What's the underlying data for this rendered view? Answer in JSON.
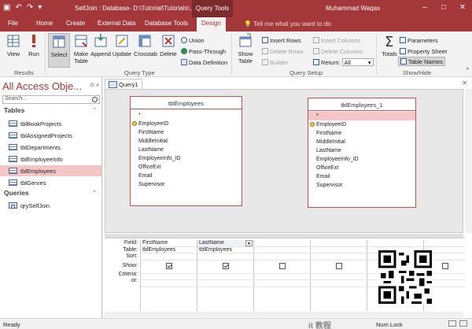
{
  "title_bar": {
    "title": "SelfJoin : Database- D:\\Tutorial\\Tutorials\\...",
    "contextual_tab": "Query Tools",
    "user": "Muhammad Waqas",
    "window_controls": [
      "–",
      "□",
      "✕"
    ]
  },
  "tabs": [
    {
      "label": "File"
    },
    {
      "label": "Home"
    },
    {
      "label": "Create"
    },
    {
      "label": "External Data"
    },
    {
      "label": "Database Tools"
    },
    {
      "label": "Design"
    }
  ],
  "tell_me": "Tell me what you want to do",
  "ribbon": {
    "results": {
      "label": "Results",
      "view": "View",
      "run": "Run"
    },
    "query_type": {
      "label": "Query Type",
      "select": "Select",
      "make_table": "Make\nTable",
      "append": "Append",
      "update": "Update",
      "crosstab": "Crosstab",
      "delete": "Delete",
      "union": "Union",
      "pass_through": "Pass-Through",
      "data_definition": "Data Definition"
    },
    "query_setup": {
      "label": "Query Setup",
      "show_table": "Show\nTable",
      "insert_rows": "Insert Rows",
      "delete_rows": "Delete Rows",
      "builder": "Builder",
      "insert_columns": "Insert Columns",
      "delete_columns": "Delete Columns",
      "return_label": "Return:",
      "return_value": "All"
    },
    "show_hide": {
      "label": "Show/Hide",
      "totals": "Totals",
      "parameters": "Parameters",
      "property_sheet": "Property Sheet",
      "table_names": "Table Names"
    }
  },
  "nav_pane": {
    "header": "All Access Obje...",
    "search_placeholder": "Search...",
    "sections": [
      {
        "title": "Tables",
        "items": [
          "tblBookProjects",
          "tblAssignedProjects",
          "tblDepartments",
          "tblEmployeeInfo",
          "tblEmployees",
          "tblGenres"
        ]
      },
      {
        "title": "Queries",
        "items": [
          "qrySelfJoin"
        ]
      }
    ],
    "selected_item": "tblEmployees"
  },
  "document": {
    "tab_label": "Query1",
    "tables": [
      {
        "name": "tblEmployees",
        "fields": [
          "*",
          "EmployeeID",
          "FirstName",
          "MiddleInitial",
          "LastName",
          "EmployeeInfo_ID",
          "OfficeExt",
          "Email",
          "Supervisor"
        ]
      },
      {
        "name": "tblEmployees_1",
        "fields": [
          "*",
          "EmployeeID",
          "FirstName",
          "MiddleInitial",
          "LastName",
          "EmployeeInfo_ID",
          "OfficeExt",
          "Email",
          "Supervisor"
        ]
      }
    ],
    "grid": {
      "row_labels": [
        "Field:",
        "Table:",
        "Sort:",
        "Show:",
        "Criteria:",
        "or:"
      ],
      "columns": [
        {
          "field": "FirstName",
          "table": "tblEmployees",
          "show": true
        },
        {
          "field": "LastName",
          "table": "tblEmployees",
          "show": true
        },
        {
          "field": "",
          "table": "",
          "show": false
        },
        {
          "field": "",
          "table": "",
          "show": false
        },
        {
          "field": "",
          "table": "",
          "show": false
        },
        {
          "field": "",
          "table": "",
          "show": false
        }
      ]
    }
  },
  "status_bar": {
    "ready": "Ready",
    "num_lock": "Num Lock",
    "brand": "it 教程"
  }
}
